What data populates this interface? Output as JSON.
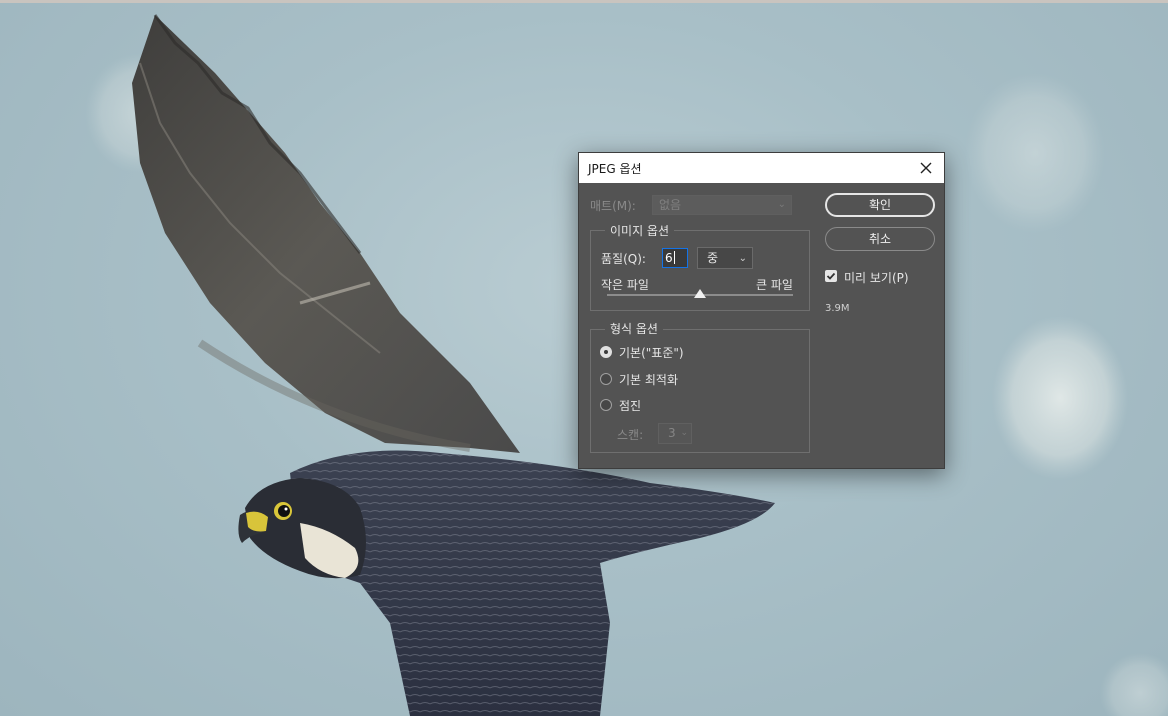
{
  "dialog": {
    "title": "JPEG 옵션",
    "matte": {
      "label": "매트(M):",
      "value": "없음"
    },
    "image_options": {
      "group_label": "이미지 옵션",
      "quality_label": "품질(Q):",
      "quality_value": "6",
      "quality_preset": "중",
      "slider_left_label": "작은 파일",
      "slider_right_label": "큰 파일",
      "slider_level_fraction": 0.5
    },
    "format_options": {
      "group_label": "형식 옵션",
      "options": [
        {
          "label": "기본(\"표준\")",
          "checked": true
        },
        {
          "label": "기본 최적화",
          "checked": false
        },
        {
          "label": "점진",
          "checked": false
        }
      ],
      "scan_label": "스캔:",
      "scan_value": "3"
    },
    "buttons": {
      "ok": "확인",
      "cancel": "취소"
    },
    "preview": {
      "label": "미리 보기(P)",
      "checked": true
    },
    "file_size": "3.9M"
  }
}
